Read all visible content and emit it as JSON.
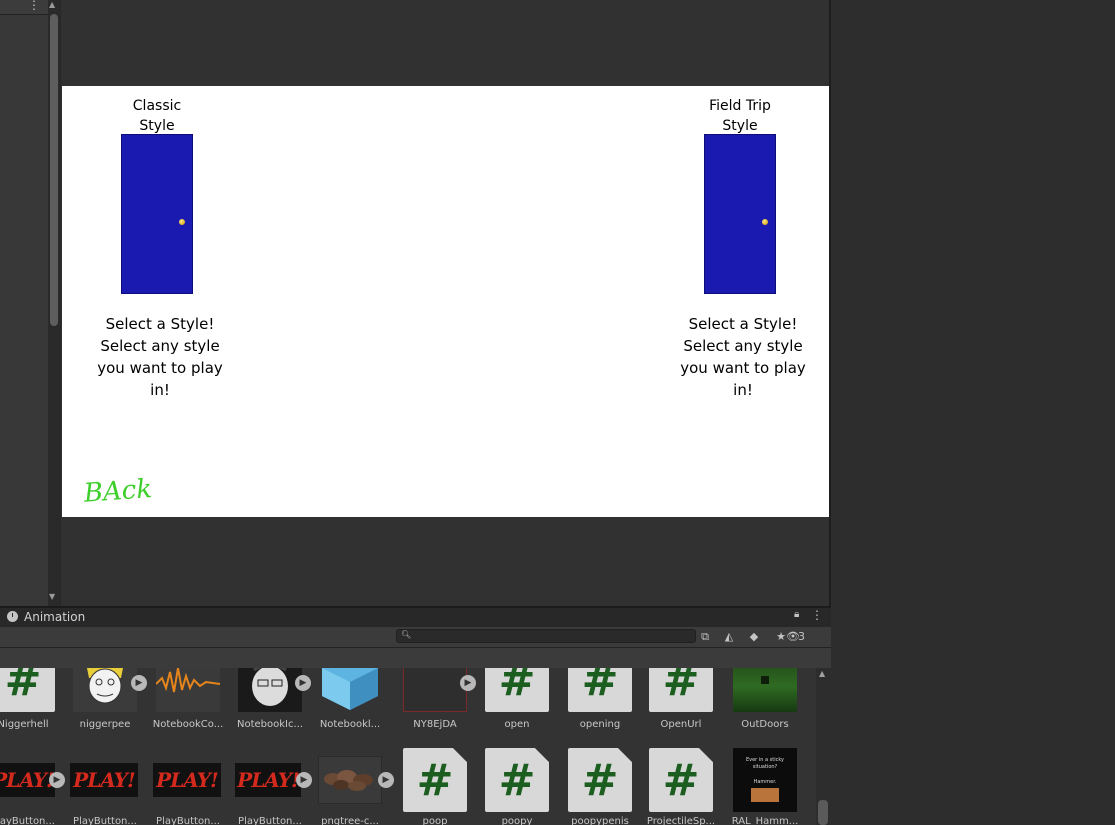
{
  "editor": {
    "left_panel_menu_icon": "kebab-icon"
  },
  "game_view": {
    "left_door": {
      "title_line1": "Classic",
      "title_line2": "Style",
      "desc_line1": "Select a Style!",
      "desc_line2": "Select any style",
      "desc_line3": "you want to play",
      "desc_line4": "in!"
    },
    "right_door": {
      "title_line1": "Field Trip",
      "title_line2": "Style",
      "desc_line1": "Select a Style!",
      "desc_line2": "Select any style",
      "desc_line3": "you want to play",
      "desc_line4": "in!"
    },
    "back_label": "BAck",
    "door_color": "#1a1ab0",
    "back_color": "#3ccf2a"
  },
  "bottom_panel": {
    "tab_label": "Animation",
    "search_placeholder": "",
    "hidden_count": "3"
  },
  "assets_row1": [
    {
      "label": "Niggerhell",
      "type": "script"
    },
    {
      "label": "niggerpee",
      "type": "image"
    },
    {
      "label": "NotebookCo...",
      "type": "audio"
    },
    {
      "label": "NotebookIc...",
      "type": "image"
    },
    {
      "label": "Notebookl...",
      "type": "prefab"
    },
    {
      "label": "NY8EjDA",
      "type": "video"
    },
    {
      "label": "open",
      "type": "script"
    },
    {
      "label": "opening",
      "type": "script"
    },
    {
      "label": "OpenUrl",
      "type": "script"
    },
    {
      "label": "OutDoors",
      "type": "image"
    }
  ],
  "assets_row2": [
    {
      "label": "PlayButton...",
      "type": "image"
    },
    {
      "label": "PlayButton...",
      "type": "image"
    },
    {
      "label": "PlayButton...",
      "type": "image"
    },
    {
      "label": "PlayButton...",
      "type": "image"
    },
    {
      "label": "pngtree-c...",
      "type": "image"
    },
    {
      "label": "poop",
      "type": "script"
    },
    {
      "label": "poopy",
      "type": "script"
    },
    {
      "label": "poopypenis",
      "type": "script"
    },
    {
      "label": "ProjectileSp...",
      "type": "script"
    },
    {
      "label": "RAL_Hamm...",
      "type": "image"
    }
  ],
  "playbutton_text": "PLAY!",
  "script_glyph": "#",
  "poster_line1": "Ever in a sticky",
  "poster_line2": "situation?",
  "poster_line3": "Hammer."
}
